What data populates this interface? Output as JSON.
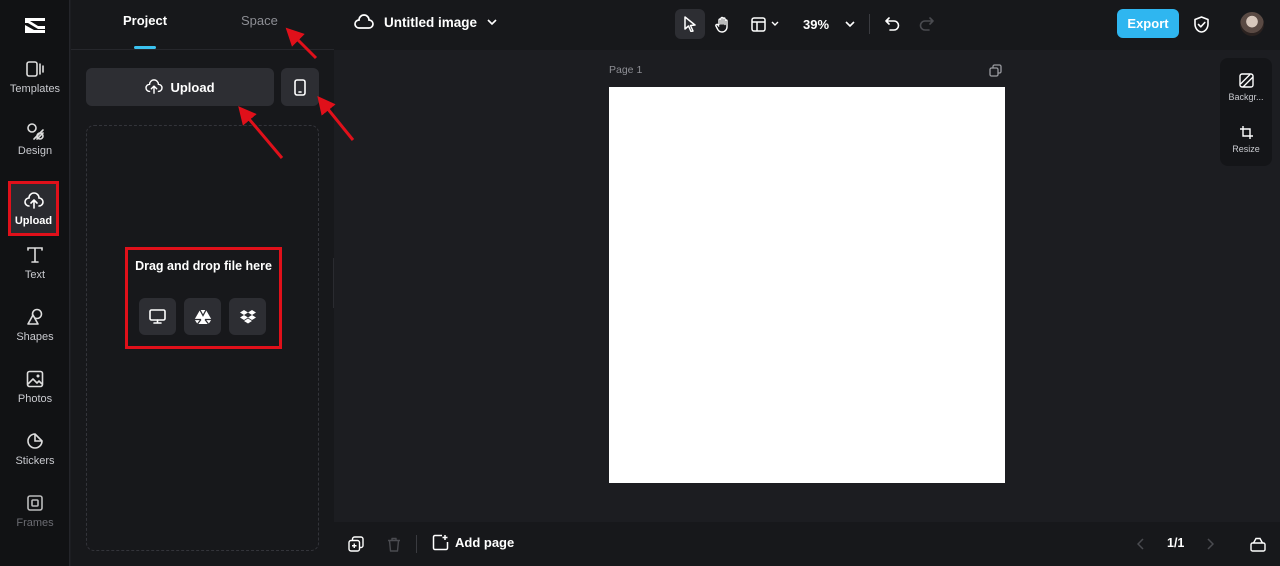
{
  "app": {
    "accent_color": "#2fb6f0",
    "highlight_color": "#e0101a",
    "logo_icon": "capcut-logo-icon"
  },
  "rail": {
    "items": [
      {
        "label": "Templates",
        "icon": "templates-icon"
      },
      {
        "label": "Design",
        "icon": "design-icon"
      },
      {
        "label": "Upload",
        "icon": "upload-cloud-icon",
        "active": true
      },
      {
        "label": "Text",
        "icon": "text-icon"
      },
      {
        "label": "Shapes",
        "icon": "shapes-icon"
      },
      {
        "label": "Photos",
        "icon": "photos-icon"
      },
      {
        "label": "Stickers",
        "icon": "stickers-icon"
      },
      {
        "label": "Frames",
        "icon": "frames-icon"
      }
    ]
  },
  "panel": {
    "tabs": [
      {
        "label": "Project",
        "active": true
      },
      {
        "label": "Space",
        "active": false
      }
    ],
    "upload_label": "Upload",
    "phone_icon": "phone-icon",
    "drop_title": "Drag and drop file here",
    "sources": [
      "computer-icon",
      "google-drive-icon",
      "dropbox-icon"
    ]
  },
  "topbar": {
    "doc_title": "Untitled image",
    "zoom": "39%",
    "export_label": "Export"
  },
  "canvas": {
    "page_label": "Page 1",
    "right_panel": [
      {
        "label": "Backgr...",
        "icon": "background-icon"
      },
      {
        "label": "Resize",
        "icon": "resize-icon"
      }
    ]
  },
  "bottombar": {
    "add_page_label": "Add page",
    "page_count": "1/1"
  }
}
